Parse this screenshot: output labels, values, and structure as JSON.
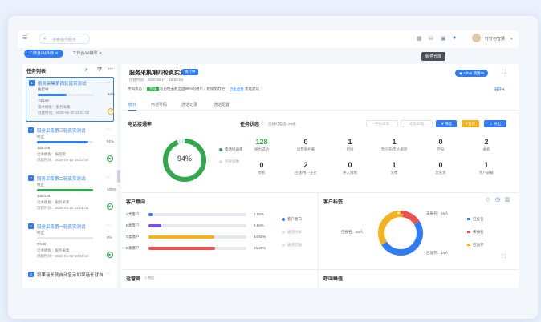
{
  "topbar": {
    "search_placeholder": "搜索操作服务",
    "user_name": "钉钉与智慧",
    "tooltip": "服务仓库"
  },
  "tabs": [
    {
      "label": "工作台/AI外呼"
    },
    {
      "label": "工作台/AI编号"
    }
  ],
  "left": {
    "title": "任务列表",
    "tasks": [
      {
        "num": "1",
        "title": "服务采集第四轮真实测试",
        "status": "执行中",
        "pct": "52%",
        "count": "74/148",
        "script": "话术模板：服务采集",
        "created": "创建时间：2020-05-20 16:21:04",
        "progress": 0.52,
        "color": "#2f7cf6"
      },
      {
        "num": "2",
        "title": "服务采集第三轮真实测试",
        "status": "终止",
        "pct": "91%",
        "count": "135/148",
        "script": "话术模板：编程版",
        "created": "创建时间：2020-05-10 15:23:04",
        "progress": 0.91,
        "color": "#2f7cf6"
      },
      {
        "num": "3",
        "title": "服务采集第二轮真实测试",
        "status": "终止",
        "pct": "100%",
        "count": "148/148",
        "script": "话术模板：服务采集",
        "created": "创建时间：2020-04-20 12:01:04",
        "progress": 1.0,
        "color": "#2fa94a"
      },
      {
        "num": "4",
        "title": "服务采集第一轮真实测试",
        "status": "终止",
        "pct": "0%",
        "count": "0/148",
        "script": "话术模板：服务采集",
        "created": "创建时间：2020-04-02 18:21:04",
        "progress": 0.0,
        "color": "#2f7cf6"
      },
      {
        "num": "5",
        "title": "如果话长就自动显示如果话长就自"
      }
    ]
  },
  "main": {
    "title": "服务采集第四轮真实测试",
    "badge": "执行中",
    "created": "创建时间：2020-05-17 · 15:58:04",
    "pill": "Allbot 调用中",
    "expand": "展开",
    "notice_prefix": "呼叫状态：",
    "notice_tag": "完成",
    "notice_text": "您已经击败全国99%的用户，继续努力吧！",
    "notice_link": "点击查看",
    "notice_suffix": "优化建议",
    "tabs": [
      "统计",
      "电话号码",
      "通话记录",
      "通话配置"
    ],
    "rate_title": "电话接通率",
    "rate_value": "94%",
    "rate_fraction": 0.94,
    "rate_legend": [
      "电话接通率",
      "外呼总数"
    ],
    "task_status_title": "任务状态",
    "task_status_sub": "已拨打电话138通",
    "date_start": "开始日期",
    "date_end": "结束日期",
    "btn_filter": "筛选",
    "btn_pause": "暂停",
    "btn_export": "导出",
    "stats_row1": [
      {
        "value": "128",
        "label": "呼出成功",
        "green": true
      },
      {
        "value": "0",
        "label": "运营商拦截"
      },
      {
        "value": "1",
        "label": "拒接"
      },
      {
        "value": "1",
        "label": "无应答/无人接听"
      },
      {
        "value": "0",
        "label": "空号"
      },
      {
        "value": "2",
        "label": "关机"
      }
    ],
    "stats_row2": [
      {
        "value": "0",
        "label": "停机"
      },
      {
        "value": "2",
        "label": "占线/用户正忙"
      },
      {
        "value": "0",
        "label": "呼入限制"
      },
      {
        "value": "1",
        "label": "欠费"
      },
      {
        "value": "0",
        "label": "黑名单"
      },
      {
        "value": "1",
        "label": "用户屏蔽"
      }
    ],
    "intent_title": "客户意向",
    "intent_rows": [
      {
        "label": "A类客户",
        "pct": "1.55%",
        "value": 0.0155,
        "color": "#2f7cf6"
      },
      {
        "label": "B类客户",
        "pct": "8.50%",
        "value": 0.085,
        "color": "#7b4de0"
      },
      {
        "label": "C类客户",
        "pct": "44.60%",
        "value": 0.446,
        "color": "#f5b21c"
      },
      {
        "label": "D类客户",
        "pct": "45.40%",
        "value": 0.454,
        "color": "#f04f4f"
      }
    ],
    "intent_legend": [
      "客户意向",
      "通话时长",
      "通话次数"
    ],
    "tag_title": "客户标签",
    "donut": {
      "slices": [
        {
          "label": "未报名：16人",
          "value": 16,
          "color": "#f04f4f"
        },
        {
          "label": "已报名：50人",
          "value": 50,
          "color": "#2f7cf6"
        },
        {
          "label": "已放弃：34人",
          "value": 34,
          "color": "#f5b21c"
        }
      ],
      "legend": [
        "已报名",
        "未报名",
        "已放弃"
      ]
    },
    "bottom_left_title": "运营商",
    "bottom_left_sub": "地区",
    "bottom_right_title": "呼叫峰值"
  }
}
